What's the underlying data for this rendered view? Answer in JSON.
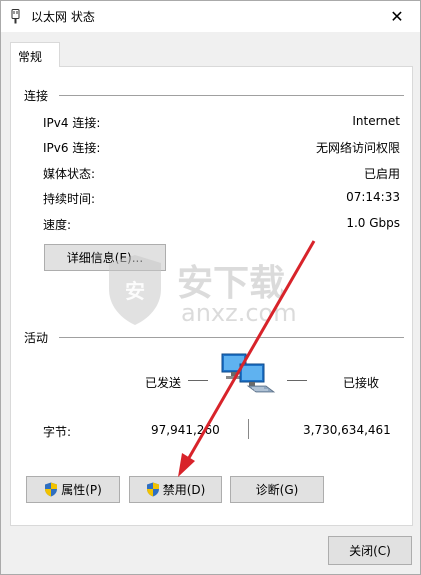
{
  "window": {
    "title": "以太网 状态",
    "close_glyph": "✕"
  },
  "tab": {
    "label": "常规"
  },
  "connection": {
    "header": "连接",
    "rows": [
      {
        "label": "IPv4 连接:",
        "value": "Internet"
      },
      {
        "label": "IPv6 连接:",
        "value": "无网络访问权限"
      },
      {
        "label": "媒体状态:",
        "value": "已启用"
      },
      {
        "label": "持续时间:",
        "value": "07:14:33"
      },
      {
        "label": "速度:",
        "value": "1.0 Gbps"
      }
    ],
    "details_button": "详细信息(E)..."
  },
  "activity": {
    "header": "活动",
    "sent_label": "已发送",
    "received_label": "已接收",
    "bytes_label": "字节:",
    "bytes_sent": "97,941,260",
    "bytes_received": "3,730,634,461"
  },
  "buttons": {
    "properties": "属性(P)",
    "disable": "禁用(D)",
    "diagnose": "诊断(G)",
    "close": "关闭(C)"
  },
  "watermark": {
    "chinese": "安下载",
    "domain": "anxz.com"
  },
  "colors": {
    "annotation_arrow": "#d8232a",
    "shield_blue": "#2f6fc1",
    "shield_yellow": "#f2c200"
  }
}
